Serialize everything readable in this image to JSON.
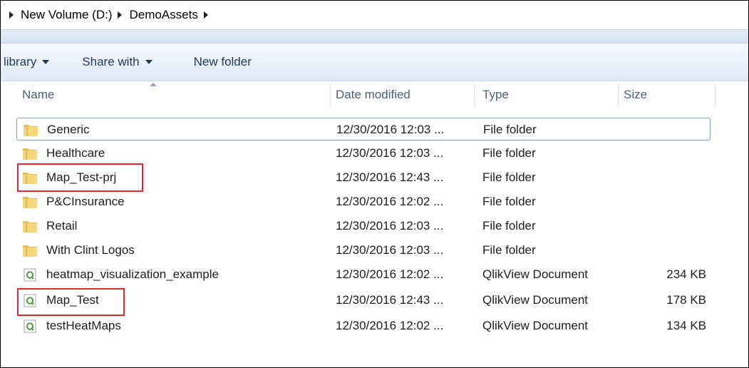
{
  "breadcrumb": [
    "New Volume (D:)",
    "DemoAssets"
  ],
  "toolbar": {
    "library_label": "library",
    "share_label": "Share with",
    "new_folder_label": "New folder"
  },
  "columns": {
    "name": "Name",
    "date": "Date modified",
    "type": "Type",
    "size": "Size"
  },
  "rows": [
    {
      "name": "Generic",
      "date": "12/30/2016 12:03 ...",
      "type": "File folder",
      "size": "",
      "icon": "folder-icon"
    },
    {
      "name": "Healthcare",
      "date": "12/30/2016 12:03 ...",
      "type": "File folder",
      "size": "",
      "icon": "folder-icon"
    },
    {
      "name": "Map_Test-prj",
      "date": "12/30/2016 12:43 ...",
      "type": "File folder",
      "size": "",
      "icon": "folder-icon"
    },
    {
      "name": "P&CInsurance",
      "date": "12/30/2016 12:02 ...",
      "type": "File folder",
      "size": "",
      "icon": "folder-icon"
    },
    {
      "name": "Retail",
      "date": "12/30/2016 12:03 ...",
      "type": "File folder",
      "size": "",
      "icon": "folder-icon"
    },
    {
      "name": "With Clint Logos",
      "date": "12/30/2016 12:03 ...",
      "type": "File folder",
      "size": "",
      "icon": "folder-icon"
    },
    {
      "name": "heatmap_visualization_example",
      "date": "12/30/2016 12:02 ...",
      "type": "QlikView Document",
      "size": "234 KB",
      "icon": "qlikview-document-icon"
    },
    {
      "name": "Map_Test",
      "date": "12/30/2016 12:43 ...",
      "type": "QlikView Document",
      "size": "178 KB",
      "icon": "qlikview-document-icon"
    },
    {
      "name": "testHeatMaps",
      "date": "12/30/2016 12:02 ...",
      "type": "QlikView Document",
      "size": "134 KB",
      "icon": "qlikview-document-icon"
    }
  ],
  "colors": {
    "highlight": "#e0282d",
    "selection": "#7da2ce",
    "folder": "#e8c05a"
  }
}
